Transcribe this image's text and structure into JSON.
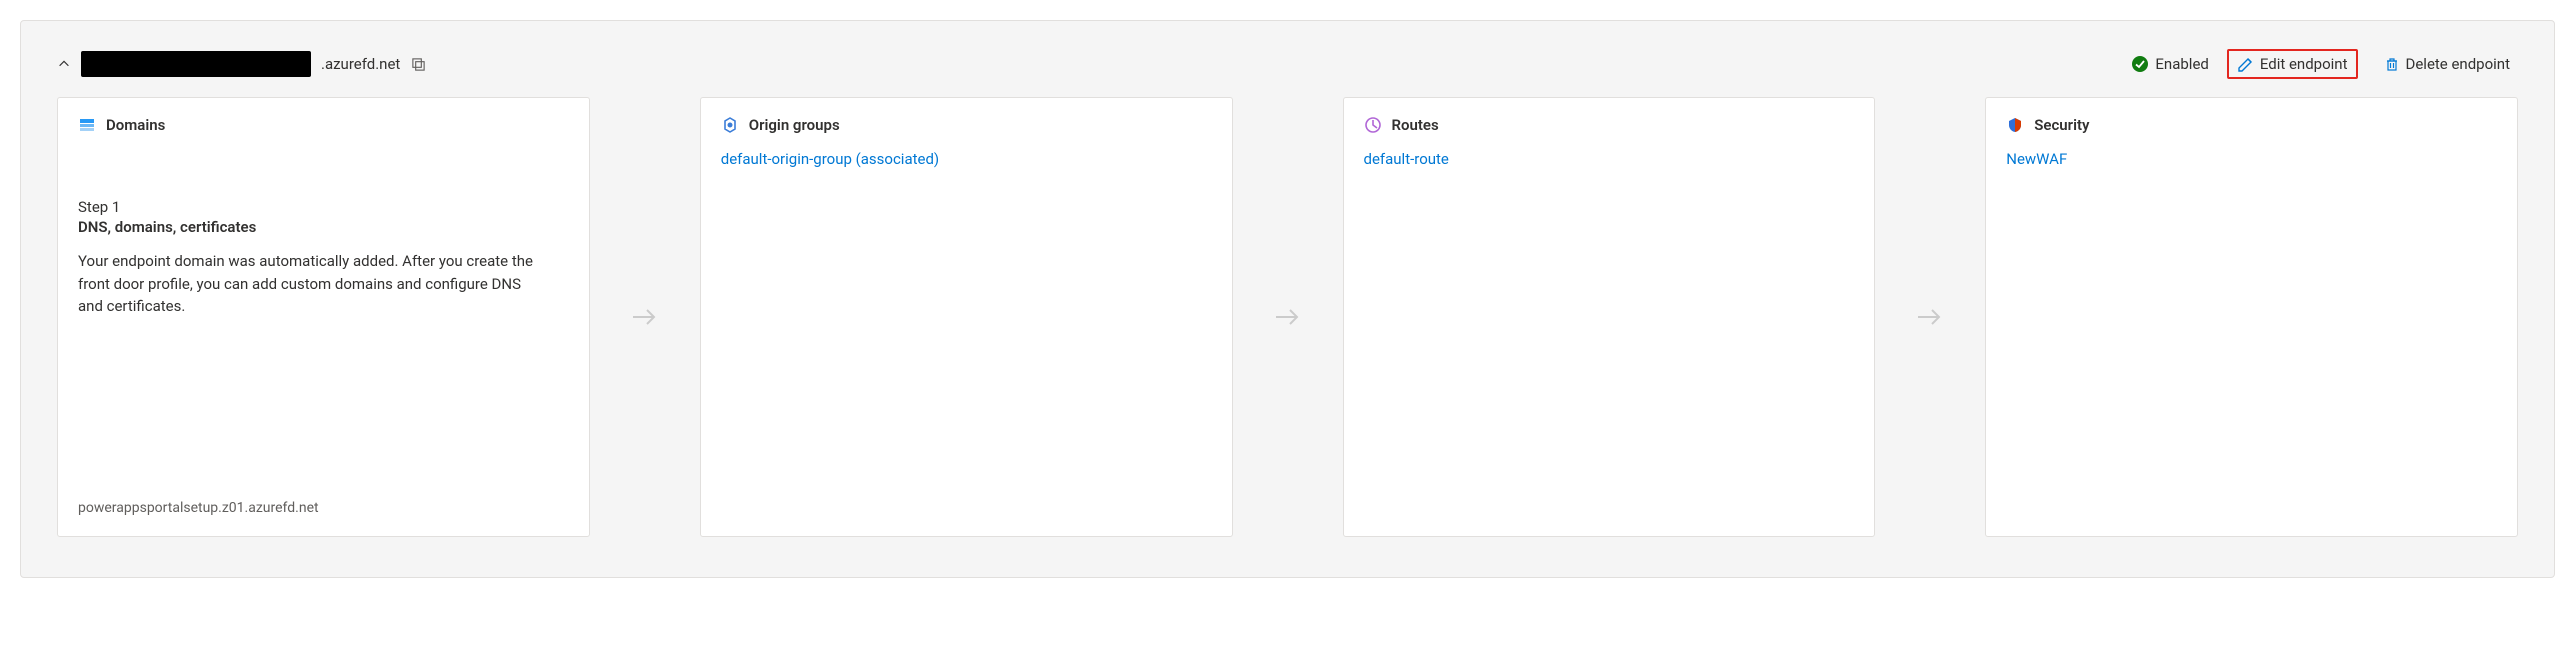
{
  "header": {
    "domain_suffix": ".azurefd.net",
    "status_label": "Enabled",
    "edit_label": "Edit endpoint",
    "delete_label": "Delete endpoint"
  },
  "cards": {
    "domains": {
      "title": "Domains",
      "step_number": "Step 1",
      "step_title": "DNS, domains, certificates",
      "step_desc": "Your endpoint domain was automatically added. After you create the front door profile, you can add custom domains and configure DNS and certificates.",
      "footnote": "powerappsportalsetup.z01.azurefd.net"
    },
    "origin_groups": {
      "title": "Origin groups",
      "link": "default-origin-group (associated)"
    },
    "routes": {
      "title": "Routes",
      "link": "default-route"
    },
    "security": {
      "title": "Security",
      "link": "NewWAF"
    }
  }
}
